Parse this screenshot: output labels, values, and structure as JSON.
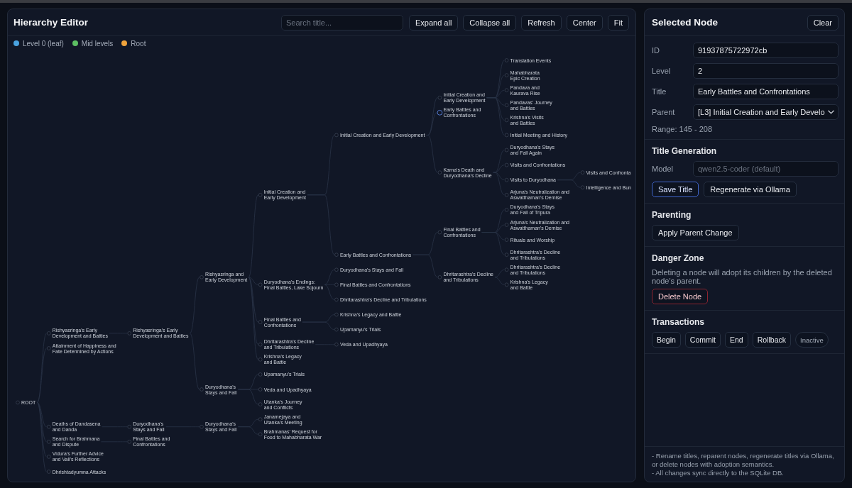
{
  "editor": {
    "title": "Hierarchy Editor",
    "search": {
      "placeholder": "Search title..."
    },
    "toolbar": [
      "Expand all",
      "Collapse all",
      "Refresh",
      "Center",
      "Fit"
    ],
    "legend": [
      {
        "label": "Level 0 (leaf)",
        "color": "#4aa3e0"
      },
      {
        "label": "Mid levels",
        "color": "#5cbf62"
      },
      {
        "label": "Root",
        "color": "#f0a33c"
      }
    ],
    "tree": {
      "label": "ROOT",
      "selected": false,
      "children": [
        {
          "label": "Rishyasringa's Early Development and Battles",
          "selected": false,
          "children": [
            {
              "label": "Rishyasringa's Early Development and Battles",
              "selected": false,
              "children": [
                {
                  "label": "Rishyasringa and Early Development",
                  "selected": false,
                  "children": [
                    {
                      "label": "Initial Creation and Early Development",
                      "selected": false,
                      "children": [
                        {
                          "label": "Initial Creation and Early Development",
                          "selected": false,
                          "children": [
                            {
                              "label": "Initial Creation and Early Development",
                              "selected": false,
                              "children": [
                                {
                                  "label": "Translation Events",
                                  "selected": false
                                },
                                {
                                  "label": "Mahabharata Epic Creation",
                                  "selected": false
                                },
                                {
                                  "label": "Pandava and Kaurava Rise",
                                  "selected": false
                                },
                                {
                                  "label": "Pandavas' Journey and Battles",
                                  "selected": false
                                },
                                {
                                  "label": "Krishna's Visits and Battles",
                                  "selected": false
                                },
                                {
                                  "label": "Initial Meeting and History",
                                  "selected": false
                                }
                              ]
                            },
                            {
                              "label": "Early Battles and Confrontations",
                              "selected": true
                            },
                            {
                              "label": "Karna's Death and Duryodhana's Decline",
                              "selected": false,
                              "children": [
                                {
                                  "label": "Duryodhana's Stays and Fall Again",
                                  "selected": false
                                },
                                {
                                  "label": "Visits and Confrontations",
                                  "selected": false
                                },
                                {
                                  "label": "Visits to Duryodhana",
                                  "selected": false,
                                  "children": [
                                    {
                                      "label": "Visits and Confronta",
                                      "selected": false
                                    },
                                    {
                                      "label": "Intelligence and Bun",
                                      "selected": false
                                    }
                                  ]
                                },
                                {
                                  "label": "Arjuna's Neutralization and Aswatthaman's Demise",
                                  "selected": false
                                }
                              ]
                            }
                          ]
                        },
                        {
                          "label": "Early Battles and Confrontations",
                          "selected": false,
                          "children": [
                            {
                              "label": "Final Battles and Confrontations",
                              "selected": false,
                              "children": [
                                {
                                  "label": "Duryodhana's Stays and Fall of Tripura",
                                  "selected": false
                                },
                                {
                                  "label": "Arjuna's Neutralization and Aswatthaman's Demise",
                                  "selected": false
                                },
                                {
                                  "label": "Rituals and Worship",
                                  "selected": false
                                },
                                {
                                  "label": "Dhritarashtra's Decline and Tribulations",
                                  "selected": false
                                }
                              ]
                            },
                            {
                              "label": "Dhritarashtra's Decline and Tribulations",
                              "selected": false,
                              "children": [
                                {
                                  "label": "Dhritarashtra's Decline and Tribulations",
                                  "selected": false
                                },
                                {
                                  "label": "Krishna's Legacy and Battle",
                                  "selected": false
                                }
                              ]
                            }
                          ]
                        }
                      ]
                    },
                    {
                      "label": "Duryodhana's Endings: Final Battles, Lake Sojourn",
                      "selected": false,
                      "children": [
                        {
                          "label": "Duryodhana's Stays and Fall",
                          "selected": false
                        },
                        {
                          "label": "Final Battles and Confrontations",
                          "selected": false
                        },
                        {
                          "label": "Dhritarashtra's Decline and Tribulations",
                          "selected": false
                        }
                      ]
                    },
                    {
                      "label": "Final Battles and Confrontations",
                      "selected": false,
                      "children": [
                        {
                          "label": "Krishna's Legacy and Battle",
                          "selected": false
                        },
                        {
                          "label": "Upamanyu's Trials",
                          "selected": false
                        }
                      ]
                    },
                    {
                      "label": "Dhritarashtra's Decline and Tribulations",
                      "selected": false,
                      "children": [
                        {
                          "label": "Veda and Upadhyaya",
                          "selected": false
                        }
                      ]
                    },
                    {
                      "label": "Krishna's Legacy and Battle",
                      "selected": false
                    }
                  ]
                },
                {
                  "label": "Duryodhana's Stays and Fall",
                  "selected": false,
                  "children": [
                    {
                      "label": "Upamanyu's Trials",
                      "selected": false
                    },
                    {
                      "label": "Veda and Upadhyaya",
                      "selected": false
                    },
                    {
                      "label": "Utanka's Journey and Conflicts",
                      "selected": false
                    }
                  ]
                }
              ]
            }
          ]
        },
        {
          "label": "Attainment of Happiness and Fate Determined by Actions",
          "selected": false
        },
        {
          "label": "Deaths of Dandasena and Danda",
          "selected": false,
          "children": [
            {
              "label": "Duryodhana's Stays and Fall",
              "selected": false,
              "children": [
                {
                  "label": "Duryodhana's Stays and Fall",
                  "selected": false,
                  "children": [
                    {
                      "label": "Janamejaya and Utanka's Meeting",
                      "selected": false
                    },
                    {
                      "label": "Brahmanas' Request for Food to Mahabharata War",
                      "selected": false
                    }
                  ]
                }
              ]
            }
          ]
        },
        {
          "label": "Search for Brahmana and Dispute",
          "selected": false,
          "children": [
            {
              "label": "Final Battles and Confrontations",
              "selected": false
            }
          ]
        },
        {
          "label": "Vidura's Further Advice and Vali's Reflections",
          "selected": false
        },
        {
          "label": "Dhrishtadyumna Attacks",
          "selected": false
        }
      ]
    }
  },
  "selected_node": {
    "title": "Selected Node",
    "clear_button": "Clear",
    "fields": [
      {
        "label": "ID",
        "value": "91937875722972cb",
        "kind": "text"
      },
      {
        "label": "Level",
        "value": "2",
        "kind": "text"
      },
      {
        "label": "Title",
        "value": "Early Battles and Confrontations",
        "kind": "text"
      },
      {
        "label": "Parent",
        "value": "[L3] Initial Creation and Early Develo",
        "kind": "select"
      }
    ],
    "range": "Range: 145 - 208",
    "title_generation": {
      "heading": "Title Generation",
      "model": {
        "label": "Model",
        "placeholder": "qwen2.5-coder (default)"
      },
      "buttons": [
        {
          "label": "Save Title",
          "kind": "primary"
        },
        {
          "label": "Regenerate via Ollama",
          "kind": "default"
        }
      ]
    },
    "parenting": {
      "heading": "Parenting",
      "button": "Apply Parent Change"
    },
    "danger_zone": {
      "heading": "Danger Zone",
      "note": "Deleting a node will adopt its children by the deleted node's parent.",
      "button": "Delete Node"
    },
    "transactions": {
      "heading": "Transactions",
      "buttons": [
        "Begin",
        "Commit",
        "End",
        "Rollback"
      ],
      "status": "Inactive"
    },
    "footer_notes": [
      "- Rename titles, reparent nodes, regenerate titles via Ollama, or delete nodes with adoption semantics.",
      "- All changes sync directly to the SQLite DB."
    ]
  }
}
